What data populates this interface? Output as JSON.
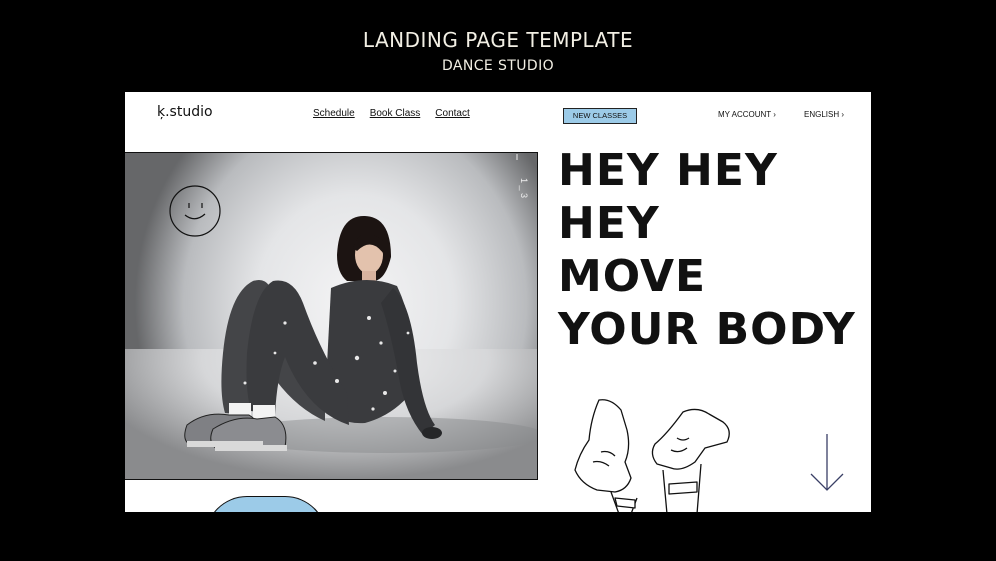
{
  "header": {
    "title": "LANDING PAGE TEMPLATE",
    "subtitle": "DANCE STUDIO"
  },
  "site": {
    "logo": "ķ.studio",
    "nav": [
      "Schedule",
      "Book Class",
      "Contact"
    ],
    "badge": "NEW CLASSES",
    "account": "MY ACCOUNT ›",
    "language": "ENGLISH ›"
  },
  "hero": {
    "lines": [
      "HEY HEY",
      "HEY",
      "MOVE",
      "YOUR BODY"
    ],
    "slide_counter": "1 _ 3"
  },
  "colors": {
    "accent": "#9ccbe8",
    "background": "#000000",
    "page": "#ffffff",
    "header_text": "#f2efe4"
  },
  "icons": [
    "smiley-doodle-icon",
    "sneakers-doodle-icon",
    "arrow-down-icon"
  ]
}
